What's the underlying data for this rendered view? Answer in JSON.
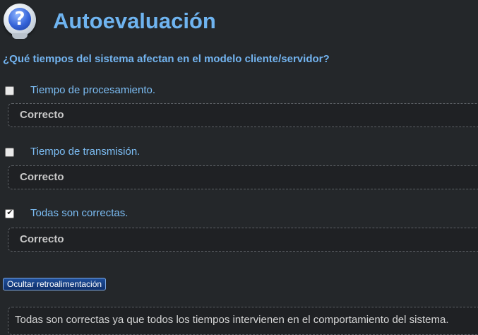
{
  "header": {
    "icon": "help-question-icon",
    "icon_glyph": "?",
    "title": "Autoevaluación"
  },
  "question": "¿Qué tiempos del sistema afectan en el modelo cliente/servidor?",
  "options": [
    {
      "label": "Tiempo de procesamiento.",
      "checked": false,
      "feedback": "Correcto"
    },
    {
      "label": "Tiempo de transmisión.",
      "checked": false,
      "feedback": "Correcto"
    },
    {
      "label": "Todas son correctas.",
      "checked": true,
      "feedback": "Correcto",
      "check_glyph": "✔"
    }
  ],
  "toggle_button": "Ocultar retroalimentación",
  "explanation": "Todas son correctas ya que todos los tiempos intervienen en el comportamiento del sistema.",
  "colors": {
    "background": "#24272a",
    "title": "#6fb4f0",
    "option_text": "#7cbdf4",
    "button": "#1f4f9a"
  }
}
